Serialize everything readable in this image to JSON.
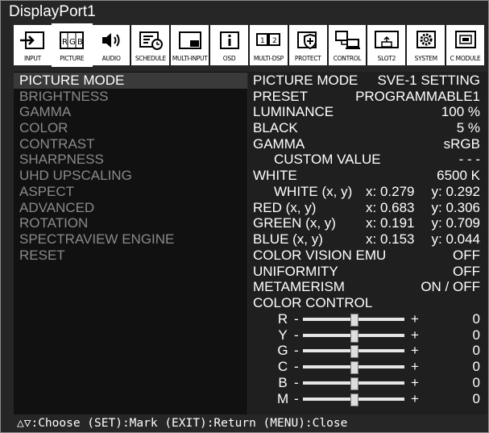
{
  "window": {
    "title": "DisplayPort1"
  },
  "tabs": [
    {
      "label": "INPUT",
      "icon": "input-icon"
    },
    {
      "label": "PICTURE",
      "icon": "picture-rgb-icon"
    },
    {
      "label": "AUDIO",
      "icon": "speaker-icon"
    },
    {
      "label": "SCHEDULE",
      "icon": "schedule-icon"
    },
    {
      "label": "MULTI-INPUT",
      "icon": "multi-input-icon"
    },
    {
      "label": "OSD",
      "icon": "info-icon"
    },
    {
      "label": "MULTI-DSP",
      "icon": "multi-display-icon"
    },
    {
      "label": "PROTECT",
      "icon": "shield-icon"
    },
    {
      "label": "CONTROL",
      "icon": "control-network-icon"
    },
    {
      "label": "SLOT2",
      "icon": "slot-icon"
    },
    {
      "label": "SYSTEM",
      "icon": "gear-icon"
    },
    {
      "label": "C MODULE",
      "icon": "compute-module-icon"
    }
  ],
  "left_menu": [
    "PICTURE MODE",
    "BRIGHTNESS",
    "GAMMA",
    "COLOR",
    "CONTRAST",
    "SHARPNESS",
    "UHD UPSCALING",
    "ASPECT",
    "ADVANCED",
    "ROTATION",
    "SPECTRAVIEW ENGINE",
    "RESET"
  ],
  "settings": {
    "picture_mode": {
      "label": "PICTURE MODE",
      "value": "SVE-1 SETTING"
    },
    "preset": {
      "label": "PRESET",
      "value": "PROGRAMMABLE1"
    },
    "luminance": {
      "label": "LUMINANCE",
      "value": "100 %"
    },
    "black": {
      "label": "BLACK",
      "value": "5 %"
    },
    "gamma": {
      "label": "GAMMA",
      "value": "sRGB"
    },
    "custom_value": {
      "label": "CUSTOM VALUE",
      "value": "- - -"
    },
    "white": {
      "label": "WHITE",
      "value": "6500 K"
    },
    "white_xy": {
      "label": "WHITE (x, y)",
      "x": "x: 0.279",
      "y": "y: 0.292"
    },
    "red_xy": {
      "label": "RED (x, y)",
      "x": "x: 0.683",
      "y": "y: 0.306"
    },
    "green_xy": {
      "label": "GREEN (x, y)",
      "x": "x: 0.191",
      "y": "y: 0.709"
    },
    "blue_xy": {
      "label": "BLUE (x, y)",
      "x": "x: 0.153",
      "y": "y: 0.044"
    },
    "color_vision_emu": {
      "label": "COLOR VISION EMU",
      "value": "OFF"
    },
    "uniformity": {
      "label": "UNIFORMITY",
      "value": "OFF"
    },
    "metamerism": {
      "label": "METAMERISM",
      "value": "ON / OFF"
    },
    "color_control": {
      "label": "COLOR CONTROL"
    }
  },
  "color_control": [
    {
      "label": "R",
      "value": "0",
      "level": 0.5
    },
    {
      "label": "Y",
      "value": "0",
      "level": 0.5
    },
    {
      "label": "G",
      "value": "0",
      "level": 0.5
    },
    {
      "label": "C",
      "value": "0",
      "level": 0.5
    },
    {
      "label": "B",
      "value": "0",
      "level": 0.5
    },
    {
      "label": "M",
      "value": "0",
      "level": 0.5
    }
  ],
  "slider_minus": "-",
  "slider_plus": "+",
  "help": "△▽:Choose (SET):Mark (EXIT):Return (MENU):Close"
}
